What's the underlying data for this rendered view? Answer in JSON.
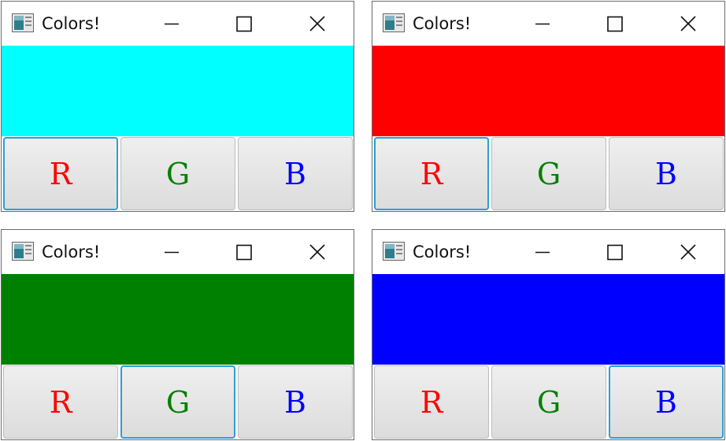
{
  "title": "Colors!",
  "button_labels": {
    "r": "R",
    "g": "G",
    "b": "B"
  },
  "label_colors": {
    "r": "#ff0000",
    "g": "#008000",
    "b": "#0000ff"
  },
  "icons": {
    "app": "app-window-icon",
    "minimize": "minimize-icon",
    "maximize": "maximize-icon",
    "close": "close-icon"
  },
  "windows": [
    {
      "swatch_color": "#00ffff",
      "focused_button": "r"
    },
    {
      "swatch_color": "#ff0000",
      "focused_button": "r"
    },
    {
      "swatch_color": "#008000",
      "focused_button": "g"
    },
    {
      "swatch_color": "#0000ff",
      "focused_button": "b"
    }
  ]
}
